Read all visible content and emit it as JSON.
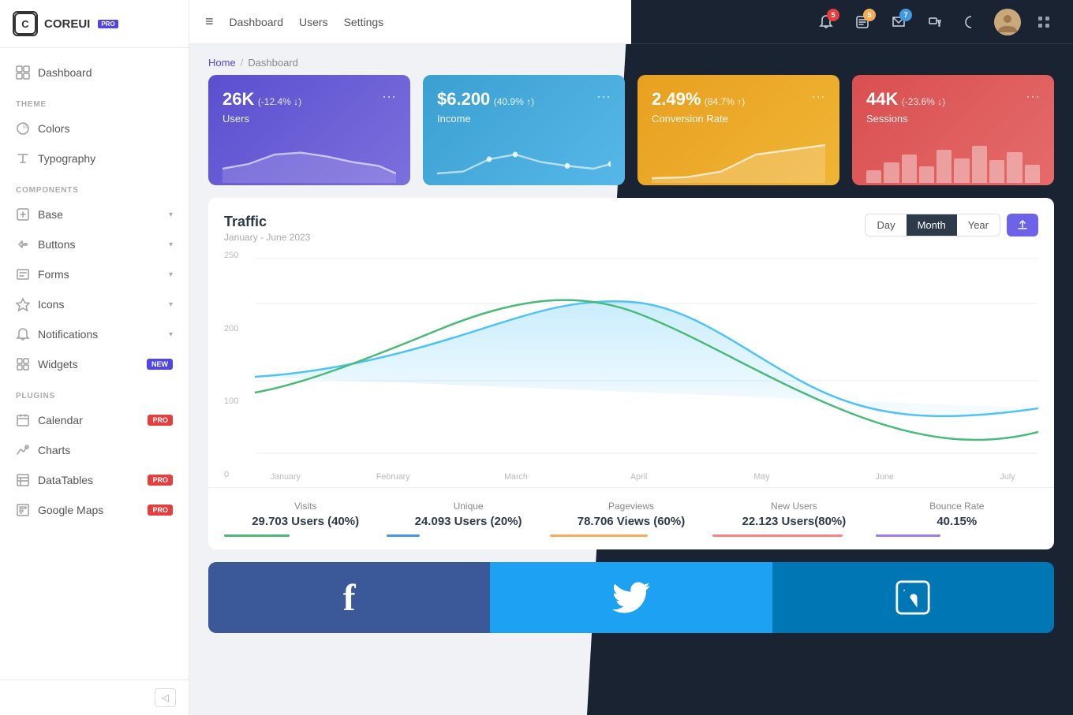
{
  "logo": {
    "icon": "C",
    "text": "COREUI",
    "badge": "PRO"
  },
  "sidebar": {
    "dashboard_label": "Dashboard",
    "theme_label": "THEME",
    "colors_label": "Colors",
    "typography_label": "Typography",
    "components_label": "COMPONENTS",
    "base_label": "Base",
    "buttons_label": "Buttons",
    "forms_label": "Forms",
    "icons_label": "Icons",
    "notifications_label": "Notifications",
    "widgets_label": "Widgets",
    "widgets_badge": "NEW",
    "plugins_label": "PLUGINS",
    "calendar_label": "Calendar",
    "calendar_badge": "PRO",
    "charts_label": "Charts",
    "datatables_label": "DataTables",
    "datatables_badge": "PRO",
    "googlemaps_label": "Google Maps",
    "googlemaps_badge": "PRO"
  },
  "header": {
    "menu_icon": "≡",
    "nav": [
      "Dashboard",
      "Users",
      "Settings"
    ],
    "notification_count": "5",
    "task_count": "5",
    "message_count": "7",
    "grid_icon": "⊞"
  },
  "breadcrumb": {
    "home": "Home",
    "current": "Dashboard"
  },
  "stats": [
    {
      "value": "26K",
      "change": "(-12.4% ↓)",
      "label": "Users",
      "color": "purple"
    },
    {
      "value": "$6.200",
      "change": "(40.9% ↑)",
      "label": "Income",
      "color": "blue"
    },
    {
      "value": "2.49%",
      "change": "(84.7% ↑)",
      "label": "Conversion Rate",
      "color": "amber"
    },
    {
      "value": "44K",
      "change": "(-23.6% ↓)",
      "label": "Sessions",
      "color": "red"
    }
  ],
  "traffic": {
    "title": "Traffic",
    "subtitle": "January - June 2023",
    "period_buttons": [
      "Day",
      "Month",
      "Year"
    ],
    "active_period": "Month",
    "y_labels": [
      "250",
      "200",
      "100",
      "0"
    ],
    "x_labels": [
      "January",
      "February",
      "March",
      "April",
      "May",
      "June",
      "July"
    ],
    "stats": [
      {
        "label": "Visits",
        "value": "29.703 Users (40%)",
        "bar_color": "green",
        "bar_width": "40"
      },
      {
        "label": "Unique",
        "value": "24.093 Users (20%)",
        "bar_color": "blue",
        "bar_width": "20"
      },
      {
        "label": "Pageviews",
        "value": "78.706 Views (60%)",
        "bar_color": "amber",
        "bar_width": "60"
      },
      {
        "label": "New Users",
        "value": "22.123 Users(80%)",
        "bar_color": "red",
        "bar_width": "80"
      },
      {
        "label": "Bounce Rate",
        "value": "40.15%",
        "bar_color": "purple",
        "bar_width": "40"
      }
    ]
  },
  "social": [
    {
      "name": "Facebook",
      "icon": "f",
      "color": "fb"
    },
    {
      "name": "Twitter",
      "icon": "🐦",
      "color": "tw"
    },
    {
      "name": "LinkedIn",
      "icon": "in",
      "color": "li"
    }
  ]
}
